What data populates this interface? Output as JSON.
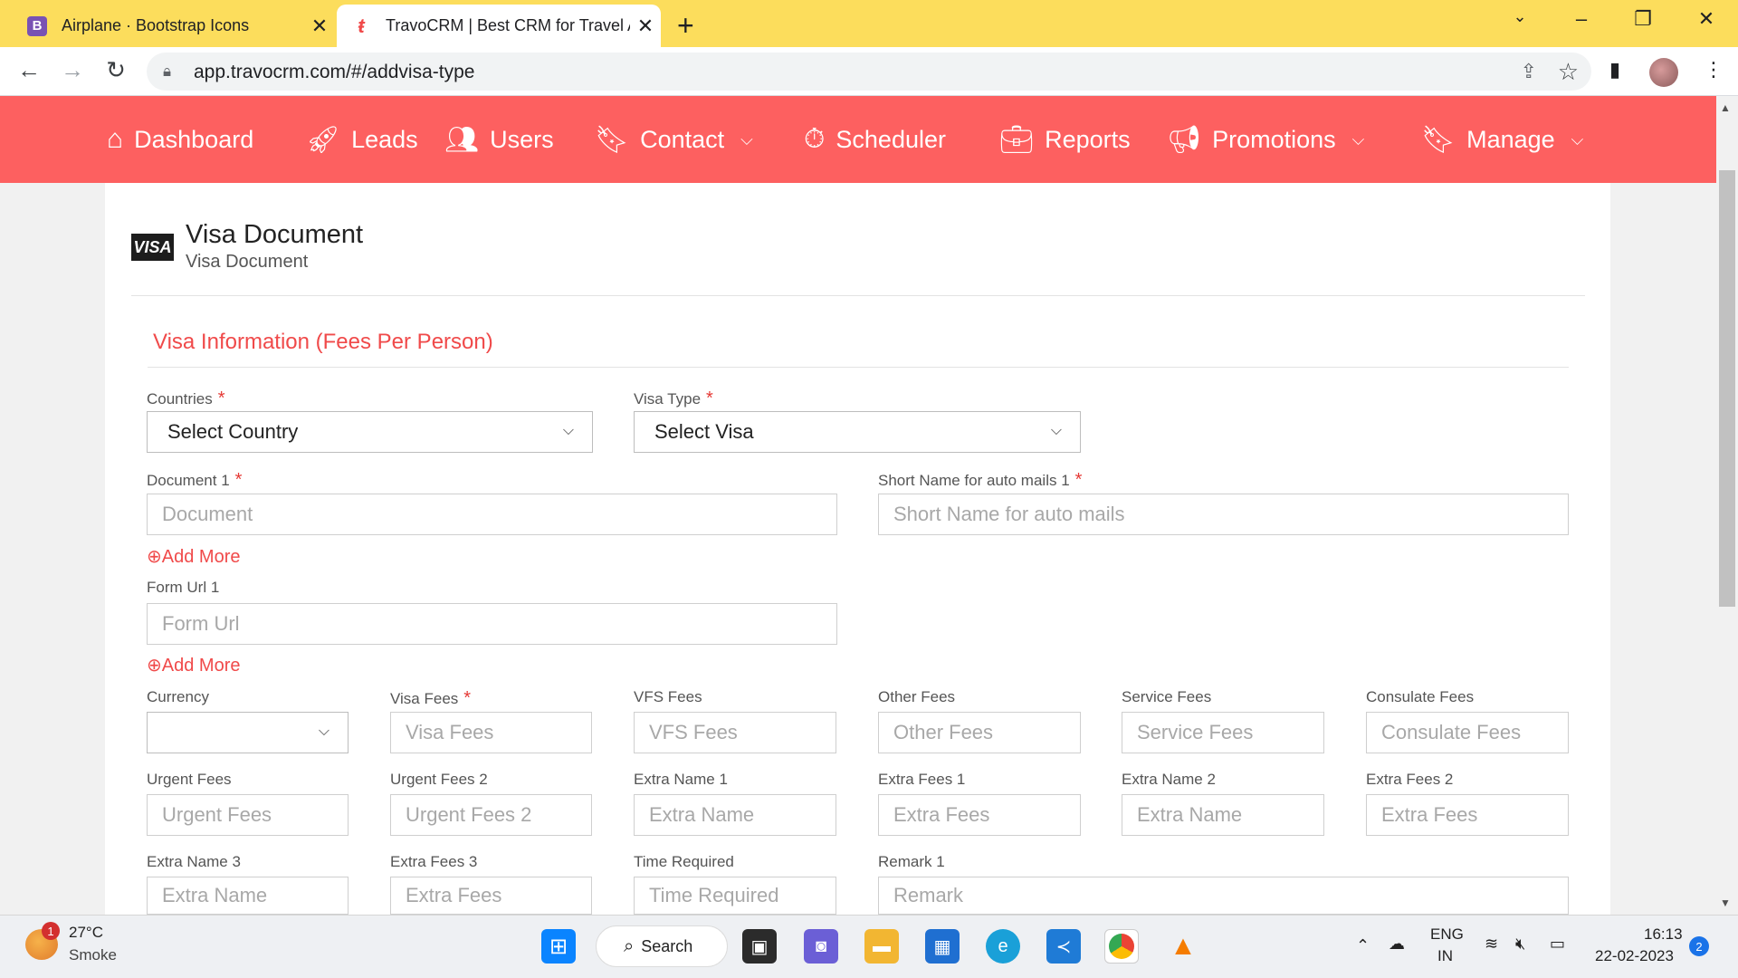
{
  "browser": {
    "tabs": [
      {
        "title": "Airplane · Bootstrap Icons",
        "favicon": "B"
      },
      {
        "title": "TravoCRM | Best CRM for Travel Agency",
        "favicon": "t"
      }
    ],
    "url": "app.travocrm.com/#/addvisa-type"
  },
  "nav": {
    "items": [
      {
        "label": "Dashboard",
        "icon": "house-icon"
      },
      {
        "label": "Leads",
        "icon": "rocket-icon"
      },
      {
        "label": "Users",
        "icon": "users-icon"
      },
      {
        "label": "Contact",
        "icon": "bookmark-icon"
      },
      {
        "label": "Scheduler",
        "icon": "stopwatch-icon"
      },
      {
        "label": "Reports",
        "icon": "briefcase-icon"
      },
      {
        "label": "Promotions",
        "icon": "megaphone-icon"
      },
      {
        "label": "Manage",
        "icon": "bookmark-icon"
      }
    ]
  },
  "page": {
    "logo_text": "VISA",
    "title": "Visa Document",
    "subtitle": "Visa Document",
    "section_title": "Visa Information (Fees Per Person)"
  },
  "form": {
    "countries_label": "Countries",
    "countries_value": "Select Country",
    "visa_type_label": "Visa Type",
    "visa_type_value": "Select Visa",
    "document_label": "Document 1",
    "document_placeholder": "Document",
    "short_name_label": "Short Name for auto mails 1",
    "short_name_placeholder": "Short Name for auto mails",
    "add_more": "Add More",
    "form_url_label": "Form Url 1",
    "form_url_placeholder": "Form Url",
    "required_mark": "*",
    "currency_label": "Currency",
    "visa_fees_label": "Visa Fees",
    "visa_fees_placeholder": "Visa Fees",
    "vfs_fees_label": "VFS Fees",
    "vfs_fees_placeholder": "VFS Fees",
    "other_fees_label": "Other Fees",
    "other_fees_placeholder": "Other Fees",
    "service_fees_label": "Service Fees",
    "service_fees_placeholder": "Service Fees",
    "consulate_fees_label": "Consulate Fees",
    "consulate_fees_placeholder": "Consulate Fees",
    "urgent_fees_label": "Urgent Fees",
    "urgent_fees_placeholder": "Urgent Fees",
    "urgent_fees2_label": "Urgent Fees 2",
    "urgent_fees2_placeholder": "Urgent Fees 2",
    "extra_name1_label": "Extra Name 1",
    "extra_name_placeholder": "Extra Name",
    "extra_fees1_label": "Extra Fees 1",
    "extra_fees_placeholder": "Extra Fees",
    "extra_name2_label": "Extra Name 2",
    "extra_fees2_label": "Extra Fees 2",
    "extra_name3_label": "Extra Name 3",
    "extra_fees3_label": "Extra Fees 3",
    "time_required_label": "Time Required",
    "time_required_placeholder": "Time Required",
    "remark_label": "Remark 1",
    "remark_placeholder": "Remark"
  },
  "taskbar": {
    "weather_temp": "27°C",
    "weather_desc": "Smoke",
    "weather_badge": "1",
    "search_label": "Search",
    "lang_top": "ENG",
    "lang_bottom": "IN",
    "time": "16:13",
    "date": "22-02-2023",
    "notification_count": "2"
  },
  "colors": {
    "accent": "#fd6060",
    "tabbar": "#fcdd5c",
    "section_title": "#f04a4a"
  }
}
